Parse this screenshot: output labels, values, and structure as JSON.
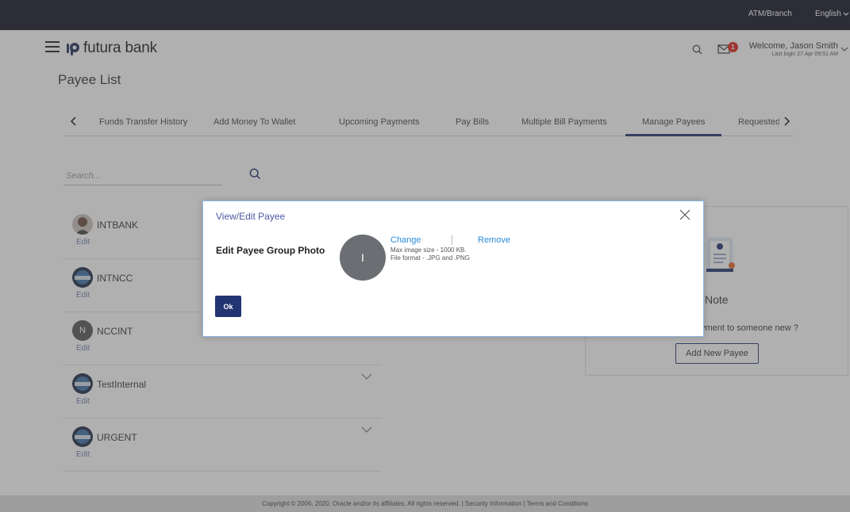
{
  "topbar": {
    "atm_branch": "ATM/Branch",
    "language": "English"
  },
  "header": {
    "brand": "futura bank",
    "notification_count": "1",
    "welcome": "Welcome, Jason Smith",
    "last_login": "Last login 27 Apr 09:51 AM"
  },
  "page": {
    "title": "Payee List"
  },
  "tabs": [
    {
      "label": "Funds Transfer History"
    },
    {
      "label": "Add Money To Wallet"
    },
    {
      "label": "Upcoming Payments"
    },
    {
      "label": "Pay Bills"
    },
    {
      "label": "Multiple Bill Payments"
    },
    {
      "label": "Manage Payees",
      "active": true
    },
    {
      "label": "Requested Funds Sum"
    }
  ],
  "search": {
    "placeholder": "Search..."
  },
  "payees": [
    {
      "name": "INTBANK",
      "edit": "Edit"
    },
    {
      "name": "INTNCC",
      "edit": "Edit"
    },
    {
      "name": "NCCINT",
      "edit": "Edit",
      "initial": "N"
    },
    {
      "name": "TestInternal",
      "edit": "Edit"
    },
    {
      "name": "URGENT",
      "edit": "Edit"
    }
  ],
  "note": {
    "title": "Note",
    "text": "yment to someone new ?",
    "button": "Add New Payee"
  },
  "modal": {
    "title": "View/Edit Payee",
    "label": "Edit Payee Group Photo",
    "avatar_initial": "I",
    "change": "Change",
    "remove": "Remove",
    "max_size": "Max image size - 1000 KB.",
    "file_format": "File format - .JPG and .PNG",
    "ok": "Ok"
  },
  "footer": {
    "text": "Copyright © 2006, 2020, Oracle and/or its affiliates. All rights reserved. | Security Information | Terms and Conditions"
  },
  "colors": {
    "primary": "#233472",
    "link": "#2c8bd6",
    "topbar": "#0f1223",
    "badge": "#e0251b"
  }
}
